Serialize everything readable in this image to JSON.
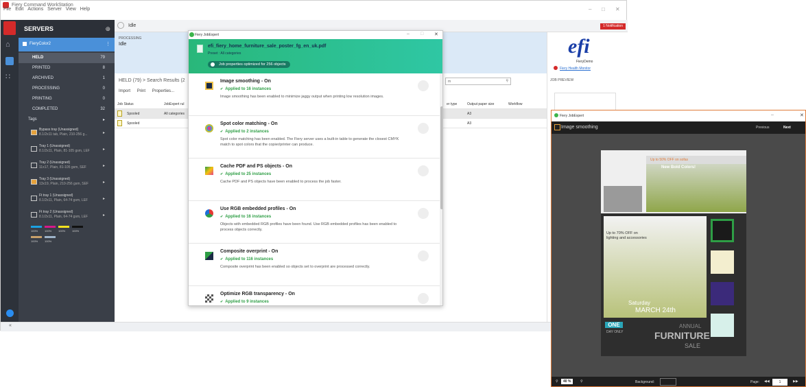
{
  "app": {
    "title": "Fiery Command WorkStation",
    "menu": [
      "File",
      "Edit",
      "Actions",
      "Server",
      "View",
      "Help"
    ]
  },
  "sidebar": {
    "header": "SERVERS",
    "server_name": "FieryColor2",
    "queues": [
      {
        "label": "HELD",
        "count": "79"
      },
      {
        "label": "PRINTED",
        "count": "8"
      },
      {
        "label": "ARCHIVED",
        "count": "1"
      },
      {
        "label": "PROCESSING",
        "count": "0"
      },
      {
        "label": "PRINTING",
        "count": "0"
      },
      {
        "label": "COMPLETED",
        "count": "32"
      }
    ],
    "tags_label": "Tags",
    "trays": [
      {
        "name": "Bypass tray (Unassigned)",
        "spec": "8.1/2x11 tab, Plain, 210-256 g..."
      },
      {
        "name": "Tray 1 (Unassigned)",
        "spec": "8.1/2x11, Plain, 81-105 gsm, LEF"
      },
      {
        "name": "Tray 2 (Unassigned)",
        "spec": "11x17, Plain, 81-105 gsm, SEF"
      },
      {
        "name": "Tray 3 (Unassigned)",
        "spec": "13x19, Plain, 210-256 gsm, SEF"
      },
      {
        "name": "Ft tray 1 (Unassigned)",
        "spec": "8.1/2x11, Plain, 64-74 gsm, LEF"
      },
      {
        "name": "Ft tray 2 (Unassigned)",
        "spec": "8.1/2x11, Plain, 64-74 gsm, LEF"
      }
    ],
    "ink_labels": [
      "100%",
      "100%",
      "100%",
      "100%",
      "100%",
      "100%"
    ]
  },
  "toolbar": {
    "status": "Idle",
    "notification": "1 Notification"
  },
  "processing": {
    "label": "PROCESSING",
    "value": "Idle"
  },
  "held": {
    "title": "HELD (79) > Search Results (2",
    "actions": [
      "Import",
      "Print",
      "Properties..."
    ],
    "search_value": "m"
  },
  "job_table": {
    "columns": [
      "Job Status",
      "JobExpert rul",
      "er type",
      "Output paper size",
      "Workflow"
    ],
    "rows": [
      {
        "status": "Spooled",
        "rule": "All categories",
        "size": "A3"
      },
      {
        "status": "Spooled",
        "rule": "",
        "size": "A3"
      }
    ]
  },
  "right_panel": {
    "logo": "efi",
    "server": "FieryDemo",
    "health": "Fiery Health Monitor",
    "job_preview": "JOB PREVIEW"
  },
  "jobexpert": {
    "title": "Fiery JobExpert",
    "file_name": "efi_fiery_home_furniture_sale_poster_fg_en_uk.pdf",
    "preset": "Preset : All categories",
    "optimized": "Job properties optimized for 256 objects",
    "items": [
      {
        "title": "Image smoothing - On",
        "applied": "Applied to 16 instances",
        "desc": "Image smoothing has been enabled to minimize jaggy output when printing low resolution images.",
        "icon": "image-smoothing-icon"
      },
      {
        "title": "Spot color matching - On",
        "applied": "Applied to 2 instances",
        "desc": "Spot color matching has been enabled. The Fiery server uses a built-in table to generate the closest CMYK match to spot colors that the copier/printer can produce.",
        "icon": "spot-color-icon"
      },
      {
        "title": "Cache PDF and PS objects - On",
        "applied": "Applied to 25 instances",
        "desc": "Cache PDF and PS objects have been enabled to process the job faster.",
        "icon": "cache-icon"
      },
      {
        "title": "Use RGB embedded profiles - On",
        "applied": "Applied to 16 instances",
        "desc": "Objects with embedded RGB profiles have been found. Use RGB embedded profiles has been enabled to process objects correctly.",
        "icon": "rgb-profile-icon"
      },
      {
        "title": "Composite overprint - On",
        "applied": "Applied to 116 instances",
        "desc": "Composite overprint has been enabled so objects set to overprint are processed correctly.",
        "icon": "overprint-icon"
      },
      {
        "title": "Optimize RGB transparency - On",
        "applied": "Applied to 9 instances",
        "desc": "",
        "icon": "transparency-icon"
      }
    ]
  },
  "preview": {
    "title": "Fiery JobExpert",
    "section": "Image smoothing",
    "prev": "Previous",
    "next": "Next",
    "zoom": "40 %",
    "background_label": "Background:",
    "page_label": "Page:",
    "page_value": "1",
    "poster": {
      "badge": "Up to 50% OFF on sofas",
      "new": "New Bold Colors!",
      "sale_pct": "Up to 70% OFF on lighting and accessories",
      "day": "Saturday",
      "date": "MARCH 24th",
      "one": "ONE",
      "day_only": "DAY ONLY",
      "annual": "ANNUAL",
      "furniture": "FURNITURE",
      "sale": "SALE"
    }
  },
  "colors": {
    "accent_green": "#29b77a",
    "held_blue": "#4a90d9",
    "sidebar_dark": "#3a3f48",
    "notification_red": "#d42a2a",
    "preview_border": "#e07b39"
  }
}
